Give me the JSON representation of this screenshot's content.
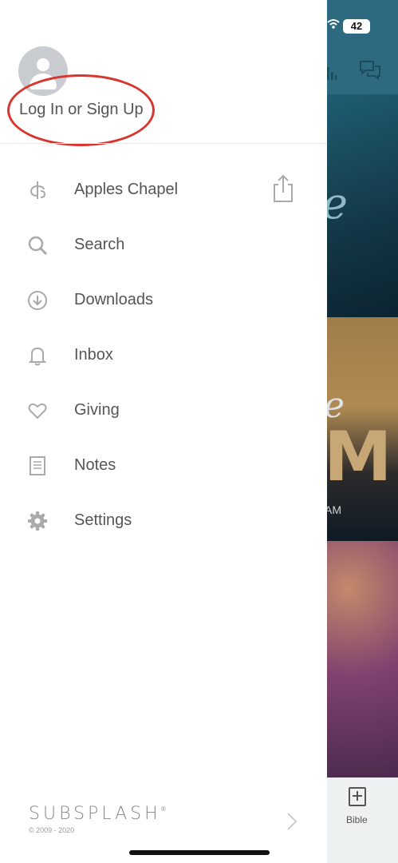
{
  "status_bar": {
    "battery": "42"
  },
  "profile": {
    "login_label": "Log In or Sign Up"
  },
  "menu": {
    "items": [
      {
        "label": "Apples Chapel",
        "icon": "church-logo-icon"
      },
      {
        "label": "Search",
        "icon": "search-icon"
      },
      {
        "label": "Downloads",
        "icon": "download-icon"
      },
      {
        "label": "Inbox",
        "icon": "bell-icon"
      },
      {
        "label": "Giving",
        "icon": "heart-icon"
      },
      {
        "label": "Notes",
        "icon": "notes-icon"
      },
      {
        "label": "Settings",
        "icon": "gear-icon"
      }
    ],
    "share_icon": "share-icon"
  },
  "footer": {
    "brand": "SUBSPLASH",
    "registered": "®",
    "copyright": "© 2009 - 2020"
  },
  "background_app": {
    "panel1_text": "e",
    "panel2_script": "e",
    "panel2_big": "M",
    "panel2_time": "AM",
    "tab_label": "Bible"
  },
  "colors": {
    "annotation_circle": "#d6362f",
    "header_bar": "#2d6a7f"
  }
}
